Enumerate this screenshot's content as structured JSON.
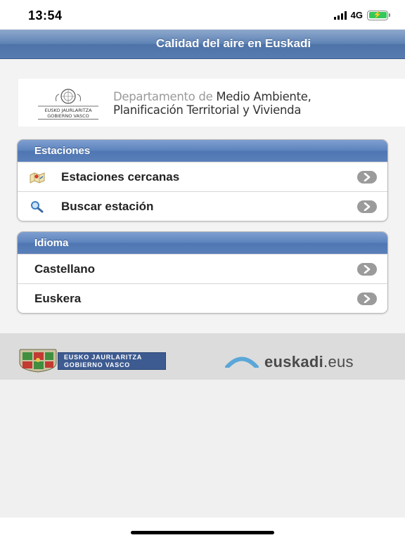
{
  "status_bar": {
    "time": "13:54",
    "network": "4G"
  },
  "navbar": {
    "title": "Calidad del aire en Euskadi"
  },
  "department_banner": {
    "emblem_caption_1": "EUSKO JAURLARITZA",
    "emblem_caption_2": "GOBIERNO VASCO",
    "line1_light": "Departamento de ",
    "line1_dark": "Medio Ambiente,",
    "line2": "Planificación Territorial y Vivienda"
  },
  "stations_group": {
    "header": "Estaciones",
    "items": [
      {
        "label": "Estaciones cercanas",
        "icon": "map-icon"
      },
      {
        "label": "Buscar estación",
        "icon": "magnifier-icon"
      }
    ]
  },
  "language_group": {
    "header": "Idioma",
    "items": [
      {
        "label": "Castellano"
      },
      {
        "label": "Euskera"
      }
    ]
  },
  "footer": {
    "gov_line1": "EUSKO JAURLARITZA",
    "gov_line2": "GOBIERNO VASCO",
    "euskadi_name": "euskadi",
    "euskadi_tld": ".eus"
  },
  "colors": {
    "nav_blue": "#557bb0",
    "header_blue": "#5c82bd",
    "battery_green": "#34c759",
    "chevron_grey": "#9b9b9b"
  }
}
